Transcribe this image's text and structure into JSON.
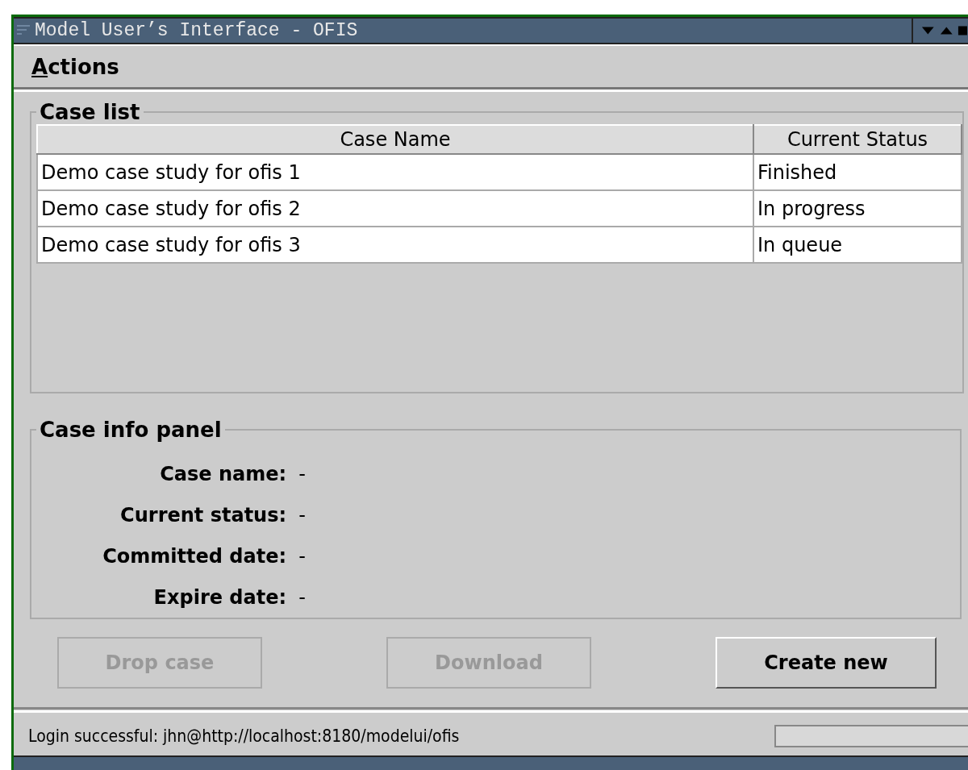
{
  "window": {
    "title": "Model User’s Interface - OFIS"
  },
  "menu": [
    "Actions"
  ],
  "case_list": {
    "title": "Case list",
    "columns": [
      "Case Name",
      "Current Status"
    ],
    "rows": [
      [
        "Demo case study for ofis 1",
        "Finished"
      ],
      [
        "Demo case study for ofis 2",
        "In progress"
      ],
      [
        "Demo case study for ofis 3",
        "In queue"
      ]
    ]
  },
  "case_info": {
    "title": "Case info panel",
    "lines": [
      "**Case name:**  -",
      "**Current status:**  -",
      "**Committed date:**  -",
      "**Expire date:**  -"
    ]
  },
  "buttons": [
    {
      "label": "Drop case",
      "disabled": true
    },
    {
      "label": "Download",
      "disabled": true
    },
    {
      "label": "Create new",
      "disabled": false
    }
  ],
  "status_bar": {
    "message": "Login successful: jhn@http://localhost:8180/modelui/ofis",
    "progress": {
      "level": 0
    }
  }
}
